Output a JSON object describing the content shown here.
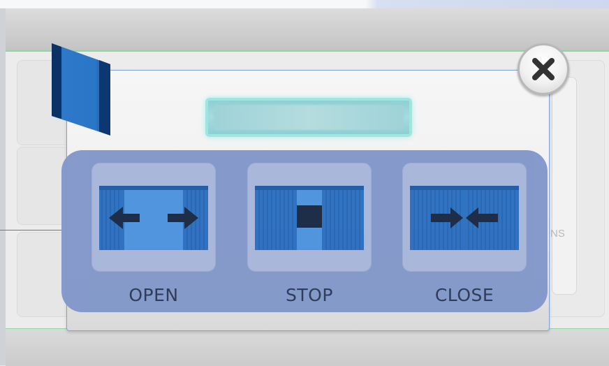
{
  "controls": {
    "open": {
      "label": "OPEN",
      "icon": "curtain-open-icon"
    },
    "stop": {
      "label": "STOP",
      "icon": "curtain-stop-icon"
    },
    "close": {
      "label": "CLOSE",
      "icon": "curtain-close-icon"
    }
  },
  "background": {
    "partial_text": "NS"
  },
  "dialog": {
    "close_icon": "close-icon",
    "title_value": ""
  },
  "colors": {
    "accent_blue": "#2a6fc0",
    "panel": "#8298c9",
    "label_text": "#2a3756",
    "title_field_glow": "#9fe6e1"
  }
}
